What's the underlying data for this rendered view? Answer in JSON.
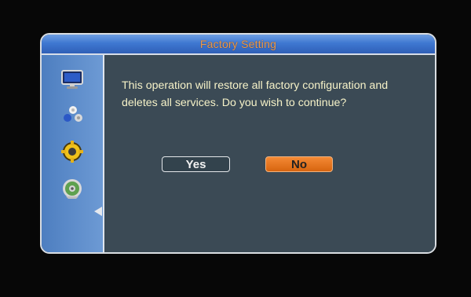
{
  "dialog": {
    "title": "Factory Setting",
    "message": "This operation will restore all factory configuration and deletes all services. Do you wish to continue?",
    "yes_label": "Yes",
    "no_label": "No"
  },
  "sidebar": {
    "items": [
      {
        "icon": "monitor-icon"
      },
      {
        "icon": "dots-icon"
      },
      {
        "icon": "gear-icon"
      },
      {
        "icon": "disc-icon",
        "selected": true
      }
    ]
  },
  "colors": {
    "title": "#e89a52",
    "message": "#f6f2c8",
    "selected_button": "#f48a35",
    "panel": "#3b4a55",
    "sidebar": "#5b8bcc"
  }
}
